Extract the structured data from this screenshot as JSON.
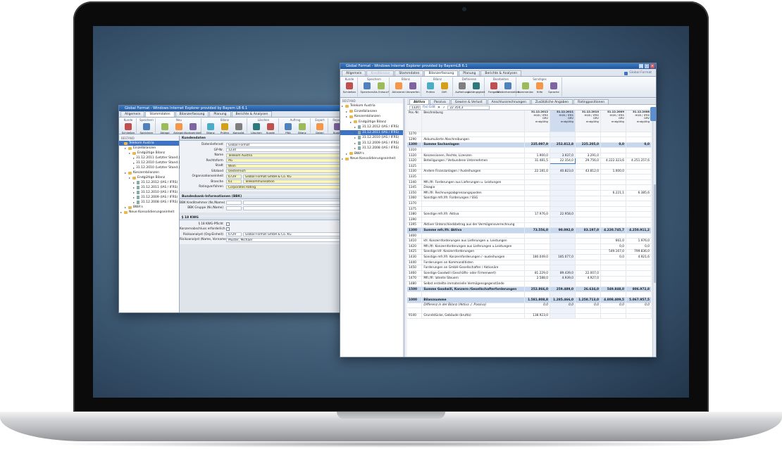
{
  "small_window": {
    "title": "Global Format - Windows Internet Explorer provided by Bayern LB 6.1",
    "tabs": [
      "Allgemein",
      "Stammdaten",
      "Bilanzerfassung",
      "Planung",
      "Berichte & Analysen"
    ],
    "ribbon_groups": [
      {
        "title": "Kunde",
        "buttons": [
          "Schließen"
        ]
      },
      {
        "title": "Speichern",
        "buttons": [
          "Speichern"
        ]
      },
      {
        "title": "Neu",
        "buttons": [
          "Ablage",
          "Anlegen",
          "Kontoeinheit"
        ]
      },
      {
        "title": "Bilanz",
        "buttons": [
          "Bilanz",
          "Prüfen",
          "Konsolid."
        ]
      },
      {
        "title": "Löschen",
        "buttons": [
          "Löschen",
          "Kunde"
        ]
      },
      {
        "title": "Auftrag",
        "buttons": [
          "PBA",
          "Bilanz"
        ]
      },
      {
        "title": "Export",
        "buttons": [
          "Daten"
        ]
      },
      {
        "title": "Report",
        "buttons": [
          "Kunde"
        ]
      },
      {
        "title": "Ansicht",
        "buttons": [
          "Bilanz",
          "Tree"
        ]
      }
    ],
    "tree_header": "BESTAND",
    "tree": [
      {
        "label": "Telekom Austria",
        "level": 0,
        "selected": true
      },
      {
        "label": "Einzelbilanzen",
        "level": 1
      },
      {
        "label": "Endgültige Bilanz",
        "level": 2
      },
      {
        "label": "31.12.2011 (Letzter Stand.)",
        "level": 3
      },
      {
        "label": "31.12.2010 (Letzter Stand.)",
        "level": 3
      },
      {
        "label": "31.12.2010 (Letzter Stand.)",
        "level": 3
      },
      {
        "label": "Konzernbilanzen",
        "level": 1
      },
      {
        "label": "Endgültige Bilanz",
        "level": 2
      },
      {
        "label": "31.12.2012 (IAS / IFRS)",
        "level": 3
      },
      {
        "label": "31.12.2011 (IAS / IFRS)",
        "level": 3
      },
      {
        "label": "31.12.2010 (IAS / IFRS)",
        "level": 3
      },
      {
        "label": "31.12.2009 (IAS / IFRS)",
        "level": 3
      },
      {
        "label": "31.12.2008 (IAS / IFRS)",
        "level": 3
      },
      {
        "label": "BWA's",
        "level": 1
      },
      {
        "label": "Neue Konsolidierungseinheit",
        "level": 0
      }
    ],
    "section1": {
      "title": "Kundendaten",
      "fields": [
        {
          "label": "Datenlieferant",
          "value": "Global Format",
          "color": "white"
        },
        {
          "label": "GP-Nr.",
          "value": "1234",
          "color": "white"
        },
        {
          "label": "Name",
          "value": "Telekom Austria",
          "color": "yellow"
        },
        {
          "label": "Rechtsform",
          "value": "AG",
          "color": "yellow"
        },
        {
          "label": "Stadt",
          "value": "Wien",
          "color": "yellow"
        },
        {
          "label": "Sitzland",
          "value": "Oesterreich",
          "color": "yellow"
        },
        {
          "label": "Organisationseinheit",
          "value": "6729",
          "value2": "Global Format GmbH & Co. KG",
          "color": "yellow"
        },
        {
          "label": "Branche",
          "value": "61",
          "value2": "Telekommunikation",
          "color": "yellow"
        },
        {
          "label": "Ratingverfahren",
          "value": "Corporates Rating",
          "color": "yellow"
        }
      ]
    },
    "section2": {
      "title": "Bundesbank-Informationen (BBK)",
      "fields": [
        {
          "label": "BBK Kreditnehmer (Nr./Name)"
        },
        {
          "label": "BBK Gruppe (Nr./Name)"
        }
      ]
    },
    "section3": {
      "title": "§ 18 KWG",
      "fields": [
        {
          "label": "§ 18 KWG-Pflicht",
          "value": "",
          "checkbox": true
        },
        {
          "label": "Konzernabschluss erforderlich",
          "value": "",
          "checkbox": true
        },
        {
          "label": "Risikoanalyst (Org-Einheit)",
          "value": "6729",
          "value2": "Global Format GmbH & Co. KG"
        },
        {
          "label": "Risikoanalyst (Name, Vorname)",
          "value": "Muster, Michael"
        }
      ]
    }
  },
  "large_window": {
    "title": "Global Format - Windows Internet Explorer provided by BayernLB 6.1",
    "tabs": [
      "Allgemein",
      "Kreditkreise",
      "Stammdaten",
      "Bilanzerfassung",
      "Planung",
      "Berichte & Analysen"
    ],
    "active_tab": "Bilanzerfassung",
    "brand": "Global Format",
    "ribbon_groups": [
      {
        "title": "Kunde",
        "buttons": [
          "Schließen"
        ]
      },
      {
        "title": "Speichern",
        "buttons": [
          "Speichern",
          "Als Entwurf"
        ]
      },
      {
        "title": "Bilanz",
        "buttons": [
          "Aktivieren",
          "Verwerfen"
        ]
      },
      {
        "title": "Bilanz2",
        "buttons": [
          "Prüfen",
          "Diff."
        ]
      },
      {
        "title": "Definieren",
        "buttons": [
          "Aufteilung",
          "Abhängigkeit"
        ]
      },
      {
        "title": "Bearbeiten",
        "buttons": [
          "Freigabe",
          "Wiederherstellen"
        ]
      },
      {
        "title": "Sonstiges",
        "buttons": [
          "Kommentar",
          "Hilfe",
          "Sprache"
        ]
      }
    ],
    "tree_header": "BESTAND",
    "tree": [
      {
        "label": "Telekom Austria",
        "level": 0,
        "icon": "folder"
      },
      {
        "label": "Einzelbilanzen",
        "level": 1,
        "icon": "folder"
      },
      {
        "label": "Konzernbilanzen",
        "level": 1,
        "icon": "folder"
      },
      {
        "label": "Endgültige Bilanz",
        "level": 2,
        "icon": "folder"
      },
      {
        "label": "31.12.2012 (IAS / IFRS)",
        "level": 3,
        "icon": "doc"
      },
      {
        "label": "31.12.2011 (IAS / IFRS)",
        "level": 3,
        "icon": "doc",
        "selected": true
      },
      {
        "label": "31.12.2010 (IAS / IFRS)",
        "level": 3,
        "icon": "doc"
      },
      {
        "label": "31.12.2009 (IAS / IFRS)",
        "level": 3,
        "icon": "doc"
      },
      {
        "label": "31.12.2008 (IAS / IFRS)",
        "level": 3,
        "icon": "doc"
      },
      {
        "label": "BWA's",
        "level": 1,
        "icon": "folder"
      },
      {
        "label": "Neue Konsolidierungseinheit",
        "level": 0,
        "icon": "folder"
      }
    ],
    "content_tabs": [
      "Aktiva",
      "Passiva",
      "Gewinn & Verlust",
      "Anschlussrechnungen",
      "Zusätzliche Angaben",
      "Ratingpositionen"
    ],
    "active_content_tab": "Aktiva",
    "formula": {
      "cell": "1320",
      "mode": "f(x) Edit",
      "value": "22 354,3"
    },
    "columns": {
      "pos": "Pos.-Nr.",
      "desc": "Beschreibung",
      "dates": [
        {
          "date": "31.12.2012",
          "lines": [
            "HGB / IFRS",
            "GRV",
            "endgültig"
          ]
        },
        {
          "date": "31.12.2011",
          "lines": [
            "HGB / IFRS",
            "GRV",
            "endgültig"
          ]
        },
        {
          "date": "31.12.2010",
          "lines": [
            "HGB / IFRS",
            "GRV",
            "endgültig"
          ]
        },
        {
          "date": "31.12.2009",
          "lines": [
            "HGB / IFRS",
            "GRV",
            "endgültig"
          ]
        },
        {
          "date": "31.12.2008",
          "lines": [
            "HGB / IFRS",
            "GRV",
            "endgültig"
          ]
        }
      ]
    },
    "rows": [
      {
        "pos": "1270",
        "desc": "",
        "vals": [
          "",
          "",
          "",
          "",
          ""
        ]
      },
      {
        "pos": "1290",
        "desc": "Akkumulierte Abschreibungen",
        "vals": [
          "",
          "",
          "",
          "",
          ""
        ]
      },
      {
        "pos": "1300",
        "desc": "Summe Sachanlagen",
        "vals": [
          "235.097,9",
          "252.812,8",
          "225.205,0",
          "0,0",
          "0,0"
        ],
        "type": "sum"
      },
      {
        "pos": "1310",
        "desc": "",
        "vals": [
          "",
          "",
          "",
          "",
          ""
        ]
      },
      {
        "pos": "1320",
        "desc": "Konzessionen, Rechte, Lizenzen",
        "vals": [
          "1.900,0",
          "3.937,0",
          "3.291,0",
          "",
          ""
        ]
      },
      {
        "pos": "1320",
        "desc": "Beteiligungen / Verbundene Unternehmen",
        "vals": [
          "31.481,5",
          "22.354,0",
          "29.756,0",
          "4.222.323,6",
          "4.251.257,6"
        ],
        "marker": true
      },
      {
        "pos": "1325",
        "desc": "",
        "vals": [
          "",
          "",
          "",
          "",
          ""
        ]
      },
      {
        "pos": "1330",
        "desc": "Andere Finanzanlagen / Ausleihungen",
        "vals": [
          "22.181,0",
          "40.823,0",
          "43.812,0",
          "1.000,0",
          ""
        ]
      },
      {
        "pos": "1335",
        "desc": "",
        "vals": [
          "",
          "",
          "",
          "",
          ""
        ]
      },
      {
        "pos": "1340",
        "desc": "Mfr./lfr. Forderungen aus Lieferungen u. Leistungen",
        "vals": [
          "",
          "",
          "",
          "",
          ""
        ]
      },
      {
        "pos": "1345",
        "desc": "Disagio",
        "vals": [
          "",
          "",
          "",
          "",
          ""
        ]
      },
      {
        "pos": "1350",
        "desc": "Mfr./lfr. Rechnungsabgrenzungsposten",
        "vals": [
          "",
          "",
          "",
          "6.221,1",
          "6.385,6"
        ]
      },
      {
        "pos": "1360",
        "desc": "Sonstige mfr./lfr. Forderungen / SSG",
        "vals": [
          "",
          "",
          "",
          "",
          ""
        ]
      },
      {
        "pos": "1370",
        "desc": "",
        "vals": [
          "",
          "",
          "",
          "",
          ""
        ]
      },
      {
        "pos": "1375",
        "desc": "",
        "vals": [
          "",
          "",
          "",
          "",
          ""
        ]
      },
      {
        "pos": "1380",
        "desc": "Sonstige mfr./lfr. Aktiva",
        "vals": [
          "17.976,0",
          "22.958,0",
          "",
          "",
          ""
        ]
      },
      {
        "pos": "1390",
        "desc": "",
        "vals": [
          "",
          "",
          "",
          "",
          ""
        ]
      },
      {
        "pos": "1395",
        "desc": "Aktiver Unterschiedsbetrag aus der Vermögensverrechnung",
        "vals": [
          "",
          "",
          "",
          "",
          ""
        ]
      },
      {
        "pos": "1300",
        "desc": "Summe mfr./lfr. Aktiva",
        "vals": [
          "73.556,0",
          "90.092,0",
          "83.197,0",
          "4.220.745,7",
          "4.250.911,2"
        ],
        "type": "sum"
      },
      {
        "pos": "1400",
        "desc": "",
        "vals": [
          "",
          "",
          "",
          "",
          ""
        ]
      },
      {
        "pos": "1410",
        "desc": "kfr. Konzernforderungen aus Lieferungen u. Leistungen",
        "vals": [
          "",
          "",
          "",
          "661,0",
          "1.976,0"
        ]
      },
      {
        "pos": "1420",
        "desc": "Mfr./lfr. Konzernforderungen aus Lieferungen u.Leistungen",
        "vals": [
          "",
          "",
          "",
          "0,0",
          "0,0"
        ]
      },
      {
        "pos": "1425",
        "desc": "Sonstige kfr. Konzernforderungen",
        "vals": [
          "",
          "",
          "",
          "549.167,0",
          "799.836,0"
        ]
      },
      {
        "pos": "1430",
        "desc": "Sonstige mfr./lfr. Konzernforderungen / -ausleihungen",
        "vals": [
          "180.049,0",
          "185.077,0",
          "",
          "0,0",
          "4.921,6"
        ]
      },
      {
        "pos": "1440",
        "desc": "Forderungen an Kommanditisten",
        "vals": [
          "",
          "",
          "",
          "",
          ""
        ]
      },
      {
        "pos": "1450",
        "desc": "Forderungen an GmbH-Gesellschafter / Aktionäre",
        "vals": [
          "",
          "",
          "",
          "",
          ""
        ]
      },
      {
        "pos": "1460",
        "desc": "Sonstige Goodwill (Geschäfts- oder Firmenwert)",
        "vals": [
          "81.229,0",
          "89.439,0",
          "22.007,0",
          "",
          ""
        ]
      },
      {
        "pos": "1470",
        "desc": "Mfr./lfr. latente Steuern",
        "vals": [
          "2.588,0",
          "4.939,0",
          "4.927,0",
          "",
          ""
        ]
      },
      {
        "pos": "1480",
        "desc": "Selbst erstellte immaterielle Vermögensgegenstände",
        "vals": [
          "",
          "",
          "",
          "",
          ""
        ]
      },
      {
        "pos": "1500",
        "desc": "Summe Goodwill, Konzern-/Gesellschafterforderungen",
        "vals": [
          "252.866,0",
          "259.489,0",
          "26.634,0",
          "549.848,0",
          "806.972,8"
        ],
        "type": "sum"
      },
      {
        "pos": "",
        "desc": "",
        "vals": [
          "",
          "",
          "",
          "",
          ""
        ]
      },
      {
        "pos": "1000",
        "desc": "Bilanzsumme",
        "vals": [
          "1.581.808,8",
          "1.285.466,0",
          "1.258.713,0",
          "4.808.409,5",
          "5.067.957,5"
        ],
        "type": "sum"
      },
      {
        "pos": "",
        "desc": "Differenz in der Bilanz (Aktiva ./. Passiva)",
        "vals": [
          "0,0",
          "0,0",
          "0,0",
          "0,0",
          "0,0"
        ],
        "type": "italic"
      },
      {
        "pos": "",
        "desc": "",
        "vals": [
          "",
          "",
          "",
          "",
          ""
        ]
      },
      {
        "pos": "9140",
        "desc": "Grundstücke, Gebäude (brutto)",
        "vals": [
          "138.923,0",
          "",
          "",
          "",
          ""
        ]
      }
    ]
  }
}
